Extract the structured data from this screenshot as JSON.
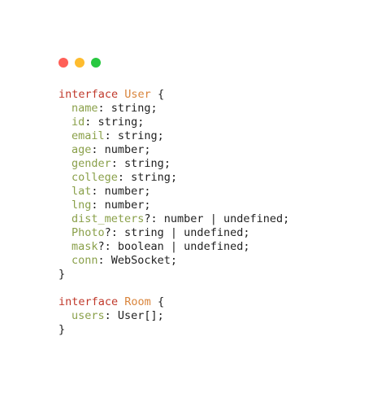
{
  "window": {
    "dots": [
      {
        "name": "close-dot",
        "color": "#ff5f57"
      },
      {
        "name": "minimize-dot",
        "color": "#febc2e"
      },
      {
        "name": "maximize-dot",
        "color": "#28c840"
      }
    ]
  },
  "colors": {
    "keyword": "#c0392b",
    "type_name": "#d9843b",
    "property": "#8aa04a",
    "text": "#1f1f1f"
  },
  "code": {
    "user_interface": {
      "keyword": "interface",
      "name": "User",
      "open": "{",
      "close": "}",
      "fields": [
        {
          "prop": "name",
          "sep": ": ",
          "type": "string;"
        },
        {
          "prop": "id",
          "sep": ": ",
          "type": "string;"
        },
        {
          "prop": "email",
          "sep": ": ",
          "type": "string;"
        },
        {
          "prop": "age",
          "sep": ": ",
          "type": "number;"
        },
        {
          "prop": "gender",
          "sep": ": ",
          "type": "string;"
        },
        {
          "prop": "college",
          "sep": ": ",
          "type": "string;"
        },
        {
          "prop": "lat",
          "sep": ": ",
          "type": "number;"
        },
        {
          "prop": "lng",
          "sep": ": ",
          "type": "number;"
        },
        {
          "prop": "dist_meters",
          "sep": "?: ",
          "type": "number | undefined;"
        },
        {
          "prop": "Photo",
          "sep": "?: ",
          "type": "string | undefined;"
        },
        {
          "prop": "mask",
          "sep": "?: ",
          "type": "boolean | undefined;"
        },
        {
          "prop": "conn",
          "sep": ": ",
          "type": "WebSocket;"
        }
      ]
    },
    "room_interface": {
      "keyword": "interface",
      "name": "Room",
      "open": "{",
      "close": "}",
      "fields": [
        {
          "prop": "users",
          "sep": ": ",
          "type": "User[];"
        }
      ]
    }
  }
}
